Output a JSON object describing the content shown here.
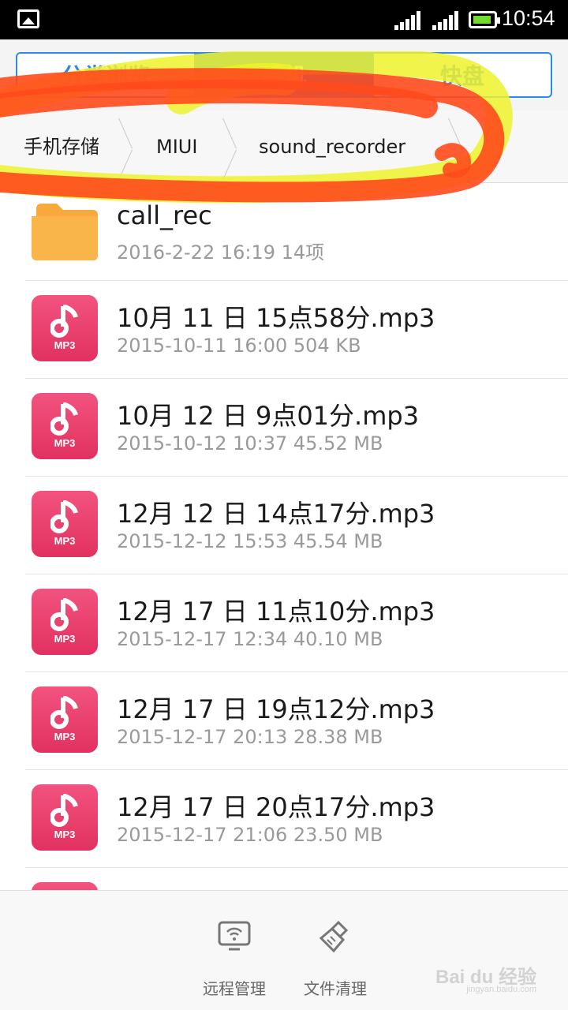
{
  "status_bar": {
    "time": "10:54",
    "icons": [
      "gallery-icon",
      "signal-icon",
      "signal-icon",
      "battery-icon"
    ]
  },
  "tabs": [
    {
      "label": "分类浏览",
      "active": false
    },
    {
      "label": "手机",
      "active": true
    },
    {
      "label": "快盘",
      "active": false
    }
  ],
  "breadcrumb": {
    "items": [
      "手机存储",
      "MIUI",
      "sound_recorder"
    ]
  },
  "files": [
    {
      "type": "folder",
      "name": "call_rec",
      "meta": "2016-2-22 16:19   14项"
    },
    {
      "type": "mp3",
      "name": "10月 11 日 15点58分.mp3",
      "meta": "2015-10-11 16:00   504 KB"
    },
    {
      "type": "mp3",
      "name": "10月 12 日 9点01分.mp3",
      "meta": "2015-10-12 10:37   45.52 MB"
    },
    {
      "type": "mp3",
      "name": "12月 12 日 14点17分.mp3",
      "meta": "2015-12-12 15:53   45.54 MB"
    },
    {
      "type": "mp3",
      "name": "12月 17 日 11点10分.mp3",
      "meta": "2015-12-17 12:34   40.10 MB"
    },
    {
      "type": "mp3",
      "name": "12月 17 日 19点12分.mp3",
      "meta": "2015-12-17 20:13   28.38 MB"
    },
    {
      "type": "mp3",
      "name": "12月 17 日 20点17分.mp3",
      "meta": "2015-12-17 21:06   23.50 MB"
    }
  ],
  "mp3_label": "MP3",
  "bottom_bar": {
    "remote": "远程管理",
    "clean": "文件清理"
  },
  "watermark": {
    "brand": "Bai du 经验",
    "url": "jingyan.baidu.com"
  },
  "colors": {
    "accent": "#2e89e8",
    "mp3": "#e23160",
    "folder": "#f7a93c",
    "highlight_yellow": "#eef22a",
    "highlight_red": "#ff4a1c"
  }
}
